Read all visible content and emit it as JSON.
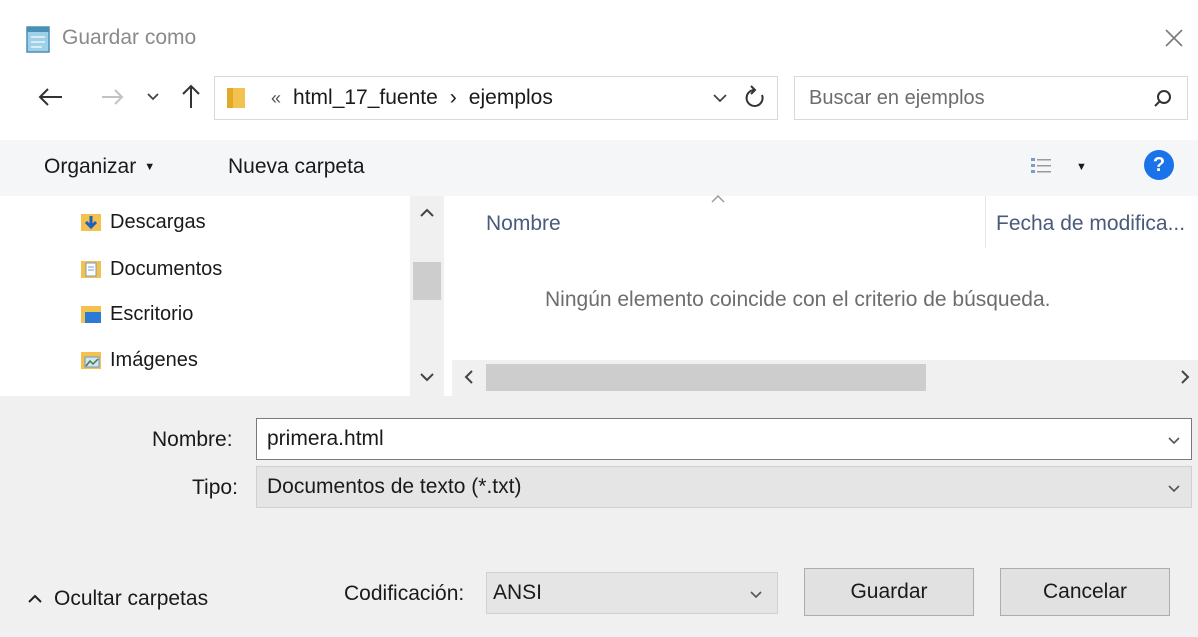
{
  "window": {
    "title": "Guardar como"
  },
  "nav": {
    "path": [
      "html_17_fuente",
      "ejemplos"
    ],
    "path_overflow": "«",
    "separator": "›",
    "search_placeholder": "Buscar en ejemplos"
  },
  "toolbar": {
    "organize_label": "Organizar",
    "new_folder_label": "Nueva carpeta"
  },
  "sidebar": {
    "items": [
      {
        "label": "Descargas",
        "icon": "downloads-folder-icon"
      },
      {
        "label": "Documentos",
        "icon": "documents-folder-icon"
      },
      {
        "label": "Escritorio",
        "icon": "desktop-folder-icon"
      },
      {
        "label": "Imágenes",
        "icon": "pictures-folder-icon"
      }
    ]
  },
  "filelist": {
    "columns": [
      "Nombre",
      "Fecha de modifica..."
    ],
    "empty_message": "Ningún elemento coincide con el criterio de búsqueda."
  },
  "form": {
    "filename_label": "Nombre:",
    "filename_value": "primera.html",
    "type_label": "Tipo:",
    "type_value": "Documentos de texto (*.txt)",
    "encoding_label": "Codificación:",
    "encoding_value": "ANSI"
  },
  "footer": {
    "hide_folders_label": "Ocultar carpetas"
  },
  "buttons": {
    "save_label": "Guardar",
    "cancel_label": "Cancelar"
  },
  "colors": {
    "folder_yellow": "#f2c14e",
    "help_blue": "#1a73e8",
    "input_border": "#7a7a7a"
  }
}
